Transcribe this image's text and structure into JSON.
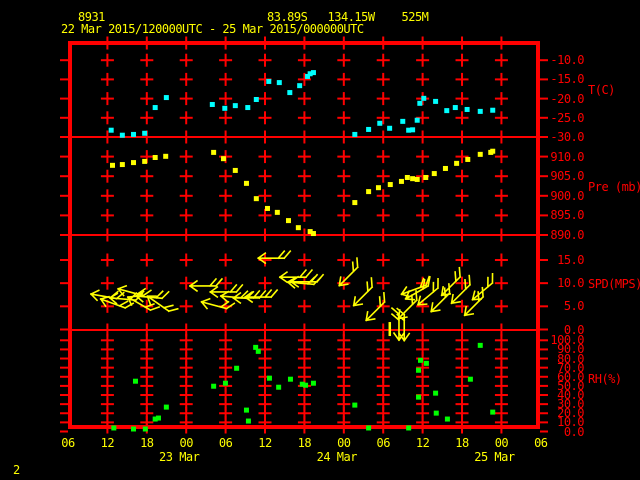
{
  "colors": {
    "background": "#000000",
    "frame": "#ff0000",
    "axis_text": "#ff0000",
    "header_text": "#ffff00",
    "temperature": "#00ffff",
    "pressure": "#ffff00",
    "wind": "#ffff00",
    "humidity": "#00ff00"
  },
  "header": {
    "station_id": "8931",
    "position": "83.89S   134.15W    525M",
    "time_range": "22 Mar 2015/120000UTC - 25 Mar 2015/000000UTC"
  },
  "footer": {
    "page_number": "2"
  },
  "x_axis": {
    "start_hour": 6,
    "end_hour": 78,
    "tick_step_hours": 6,
    "hour_labels": [
      "06",
      "12",
      "18",
      "00",
      "06",
      "12",
      "18",
      "00",
      "06",
      "12",
      "18",
      "00",
      "06"
    ],
    "date_labels": [
      {
        "hour": 24,
        "label": "23 Mar"
      },
      {
        "hour": 48,
        "label": "24 Mar"
      },
      {
        "hour": 72,
        "label": "25 Mar"
      }
    ]
  },
  "chart_data": [
    {
      "type": "scatter",
      "name": "temperature",
      "unit_label": "T(C)",
      "color": "#00ffff",
      "ylim": [
        -30,
        -5
      ],
      "grid_values": [
        -10,
        -15,
        -20,
        -25
      ],
      "yticks": [
        {
          "v": -10,
          "label": "-10.0"
        },
        {
          "v": -15,
          "label": "-15.0"
        },
        {
          "v": -20,
          "label": "-20.0"
        },
        {
          "v": -25,
          "label": "-25.0"
        },
        {
          "v": -30,
          "label": "-30.0"
        }
      ],
      "points": [
        [
          12.5,
          -28.1
        ],
        [
          14.2,
          -29.4
        ],
        [
          15.9,
          -29.2
        ],
        [
          17.6,
          -28.9
        ],
        [
          19.2,
          -22.2
        ],
        [
          20.9,
          -19.6
        ],
        [
          27.9,
          -21.4
        ],
        [
          29.8,
          -22.4
        ],
        [
          31.4,
          -21.7
        ],
        [
          33.3,
          -22.2
        ],
        [
          34.6,
          -20.1
        ],
        [
          36.5,
          -15.4
        ],
        [
          38.1,
          -15.7
        ],
        [
          39.7,
          -18.3
        ],
        [
          41.2,
          -16.5
        ],
        [
          42.4,
          -14.1
        ],
        [
          42.8,
          -13.4
        ],
        [
          43.3,
          -13.1
        ],
        [
          49.6,
          -29.2
        ],
        [
          51.7,
          -27.9
        ],
        [
          53.4,
          -26.3
        ],
        [
          54.9,
          -27.6
        ],
        [
          56.9,
          -25.8
        ],
        [
          57.8,
          -28.1
        ],
        [
          58.4,
          -28.0
        ],
        [
          59.1,
          -25.5
        ],
        [
          59.5,
          -21.1
        ],
        [
          60.1,
          -19.8
        ],
        [
          61.9,
          -20.6
        ],
        [
          63.6,
          -23.0
        ],
        [
          64.9,
          -22.2
        ],
        [
          66.7,
          -22.7
        ],
        [
          68.7,
          -23.2
        ],
        [
          70.6,
          -22.9
        ]
      ]
    },
    {
      "type": "scatter",
      "name": "pressure",
      "unit_label": "Pre (mb)",
      "color": "#ffff00",
      "ylim": [
        890,
        915
      ],
      "grid_values": [
        910,
        905,
        900,
        895
      ],
      "yticks": [
        {
          "v": 910,
          "label": "910.0"
        },
        {
          "v": 905,
          "label": "905.0"
        },
        {
          "v": 900,
          "label": "900.0"
        },
        {
          "v": 895,
          "label": "895.0"
        },
        {
          "v": 890,
          "label": "890.0"
        }
      ],
      "points": [
        [
          12.7,
          907.9
        ],
        [
          14.2,
          908.1
        ],
        [
          15.9,
          908.6
        ],
        [
          17.6,
          908.9
        ],
        [
          19.2,
          909.9
        ],
        [
          20.8,
          910.2
        ],
        [
          28.1,
          911.2
        ],
        [
          29.6,
          909.6
        ],
        [
          31.4,
          906.6
        ],
        [
          33.1,
          903.3
        ],
        [
          34.6,
          899.4
        ],
        [
          36.3,
          896.9
        ],
        [
          37.8,
          895.9
        ],
        [
          39.5,
          893.8
        ],
        [
          41.0,
          892.0
        ],
        [
          42.8,
          891.0
        ],
        [
          43.3,
          890.5
        ],
        [
          49.6,
          898.4
        ],
        [
          51.7,
          901.2
        ],
        [
          53.2,
          902.2
        ],
        [
          55.0,
          903.0
        ],
        [
          56.7,
          903.8
        ],
        [
          57.6,
          904.8
        ],
        [
          58.4,
          904.5
        ],
        [
          59.1,
          904.3
        ],
        [
          60.4,
          904.8
        ],
        [
          61.7,
          905.8
        ],
        [
          63.4,
          907.1
        ],
        [
          65.1,
          908.4
        ],
        [
          66.8,
          909.4
        ],
        [
          68.7,
          910.7
        ],
        [
          70.3,
          911.2
        ],
        [
          70.6,
          911.5
        ]
      ]
    },
    {
      "type": "wind",
      "name": "wind_speed",
      "unit_label": "SPD(MPS)",
      "color": "#ffff00",
      "ylim": [
        0,
        20
      ],
      "grid_values": [
        15,
        10,
        5
      ],
      "yticks": [
        {
          "v": 15,
          "label": "15.0"
        },
        {
          "v": 10,
          "label": "10.0"
        },
        {
          "v": 5,
          "label": "5.0"
        },
        {
          "v": 0,
          "label": "0.0"
        }
      ],
      "barbs": [
        {
          "h": 11.3,
          "spd": 7.2,
          "dir": 190
        },
        {
          "h": 12.7,
          "spd": 5.7,
          "dir": 200
        },
        {
          "h": 14.2,
          "spd": 6.6,
          "dir": 185
        },
        {
          "h": 15.4,
          "spd": 8.1,
          "dir": 195
        },
        {
          "h": 16.7,
          "spd": 5.7,
          "dir": 210
        },
        {
          "h": 18.2,
          "spd": 7.0,
          "dir": 185
        },
        {
          "h": 19.6,
          "spd": 5.7,
          "dir": 215
        },
        {
          "h": 26.4,
          "spd": 9.4,
          "dir": 180
        },
        {
          "h": 28.1,
          "spd": 5.3,
          "dir": 195
        },
        {
          "h": 29.5,
          "spd": 8.1,
          "dir": 180
        },
        {
          "h": 31.1,
          "spd": 7.0,
          "dir": 185
        },
        {
          "h": 33.0,
          "spd": 6.8,
          "dir": 180
        },
        {
          "h": 34.8,
          "spd": 7.0,
          "dir": 180
        },
        {
          "h": 36.8,
          "spd": 15.4,
          "dir": 180
        },
        {
          "h": 40.1,
          "spd": 11.3,
          "dir": 180
        },
        {
          "h": 41.3,
          "spd": 10.0,
          "dir": 185
        },
        {
          "h": 41.8,
          "spd": 10.3,
          "dir": 180
        },
        {
          "h": 48.6,
          "spd": 11.3,
          "dir": 135
        },
        {
          "h": 50.8,
          "spd": 7.0,
          "dir": 135
        },
        {
          "h": 52.7,
          "spd": 3.8,
          "dir": 135
        },
        {
          "h": 55.0,
          "spd": 0.1,
          "dir": 90,
          "calm": true
        },
        {
          "h": 56.4,
          "spd": 0.3,
          "dir": 90
        },
        {
          "h": 57.2,
          "spd": 0.2,
          "dir": 90
        },
        {
          "h": 57.6,
          "spd": 4.2,
          "dir": 135
        },
        {
          "h": 58.5,
          "spd": 8.5,
          "dir": 160
        },
        {
          "h": 59.0,
          "spd": 7.9,
          "dir": 150
        },
        {
          "h": 60.7,
          "spd": 7.0,
          "dir": 140
        },
        {
          "h": 62.6,
          "spd": 5.7,
          "dir": 135
        },
        {
          "h": 64.2,
          "spd": 9.2,
          "dir": 135
        },
        {
          "h": 65.7,
          "spd": 7.5,
          "dir": 135
        },
        {
          "h": 67.7,
          "spd": 4.9,
          "dir": 135
        },
        {
          "h": 69.0,
          "spd": 8.1,
          "dir": 140
        }
      ]
    },
    {
      "type": "scatter",
      "name": "relative_humidity",
      "unit_label": "RH(%)",
      "color": "#00ff00",
      "ylim": [
        0,
        100
      ],
      "grid_values": [
        100,
        90,
        80,
        70,
        60,
        50,
        40,
        30,
        20,
        10
      ],
      "yticks": [
        {
          "v": 100,
          "label": "100.0"
        },
        {
          "v": 90,
          "label": "90.0"
        },
        {
          "v": 80,
          "label": "80.0"
        },
        {
          "v": 70,
          "label": "70.0"
        },
        {
          "v": 60,
          "label": "60.0"
        },
        {
          "v": 50,
          "label": "50.0"
        },
        {
          "v": 40,
          "label": "40.0"
        },
        {
          "v": 30,
          "label": "30.0"
        },
        {
          "v": 20,
          "label": "20.0"
        },
        {
          "v": 10,
          "label": "10.0"
        },
        {
          "v": 0,
          "label": "0.0"
        }
      ],
      "points": [
        [
          12.9,
          4.4
        ],
        [
          15.9,
          3.3
        ],
        [
          16.2,
          55.7
        ],
        [
          17.7,
          3.3
        ],
        [
          19.2,
          14.2
        ],
        [
          19.7,
          15.3
        ],
        [
          20.9,
          27.3
        ],
        [
          28.1,
          50.2
        ],
        [
          29.9,
          53.5
        ],
        [
          31.6,
          69.9
        ],
        [
          33.1,
          24.0
        ],
        [
          33.4,
          12.0
        ],
        [
          34.5,
          92.8
        ],
        [
          34.9,
          88.4
        ],
        [
          36.6,
          59.0
        ],
        [
          38.0,
          49.1
        ],
        [
          39.8,
          57.9
        ],
        [
          41.6,
          52.4
        ],
        [
          42.1,
          51.3
        ],
        [
          43.3,
          53.5
        ],
        [
          49.6,
          29.5
        ],
        [
          51.7,
          4.4
        ],
        [
          57.8,
          4.4
        ],
        [
          59.3,
          67.7
        ],
        [
          59.3,
          38.2
        ],
        [
          59.6,
          78.6
        ],
        [
          60.5,
          75.3
        ],
        [
          61.9,
          42.6
        ],
        [
          62.0,
          20.7
        ],
        [
          63.7,
          14.2
        ],
        [
          67.2,
          57.9
        ],
        [
          68.7,
          95.0
        ],
        [
          70.6,
          21.8
        ]
      ]
    }
  ]
}
